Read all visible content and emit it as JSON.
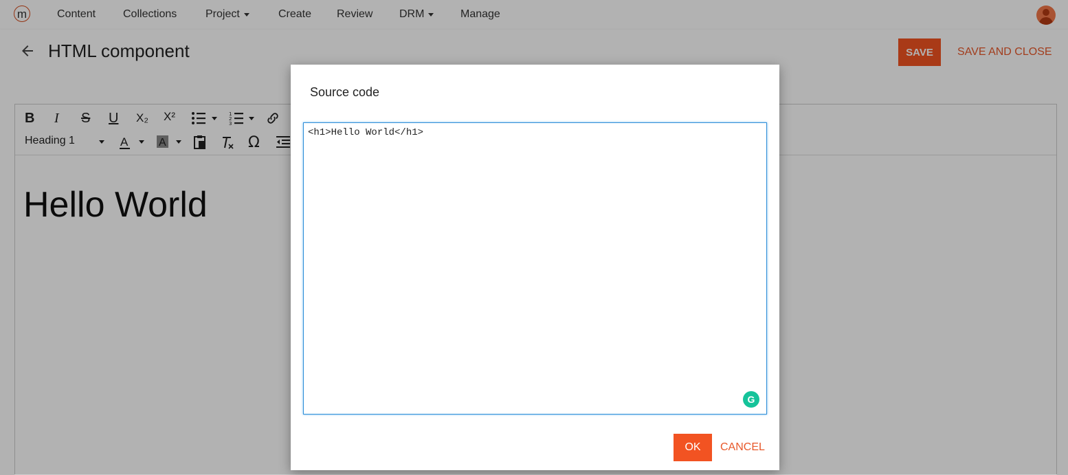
{
  "nav": {
    "logo_letter": "m",
    "items": [
      {
        "label": "Content",
        "has_dropdown": false
      },
      {
        "label": "Collections",
        "has_dropdown": false
      },
      {
        "label": "Project",
        "has_dropdown": true
      },
      {
        "label": "Create",
        "has_dropdown": false
      },
      {
        "label": "Review",
        "has_dropdown": false
      },
      {
        "label": "DRM",
        "has_dropdown": true
      },
      {
        "label": "Manage",
        "has_dropdown": false
      }
    ],
    "avatar_icon": "user-avatar-icon"
  },
  "header": {
    "title": "HTML component",
    "save_label": "SAVE",
    "save_close_label": "SAVE AND CLOSE"
  },
  "editor": {
    "toolbar_row1": [
      "B",
      "I",
      "S",
      "U",
      "X₂",
      "X²"
    ],
    "format_value": "Heading 1",
    "content_text": "Hello World"
  },
  "dialog": {
    "title": "Source code",
    "source_value": "<h1>Hello World</h1>",
    "ok_label": "OK",
    "cancel_label": "CANCEL",
    "grammarly_letter": "G"
  },
  "colors": {
    "accent": "#f25322",
    "accent_text": "#e8582a",
    "focus_border": "#2f8fd8",
    "grammarly": "#15c39a"
  }
}
